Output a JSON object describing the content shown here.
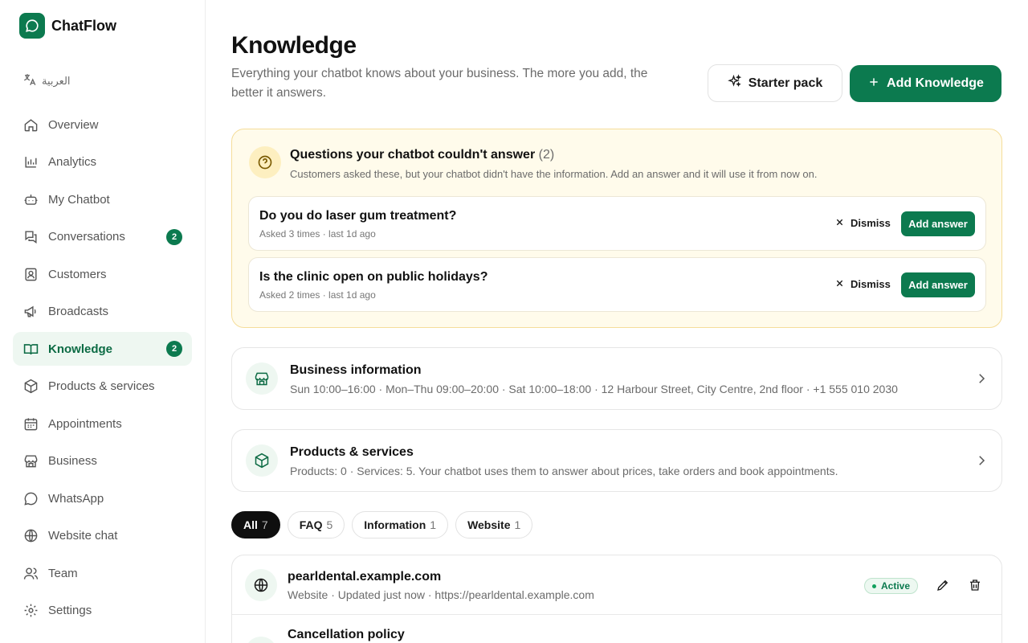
{
  "app": {
    "name": "ChatFlow"
  },
  "sidebar": {
    "language": "العربية",
    "items": [
      {
        "label": "Overview",
        "icon": "home-icon"
      },
      {
        "label": "Analytics",
        "icon": "bar-chart-icon"
      },
      {
        "label": "My Chatbot",
        "icon": "bot-icon"
      },
      {
        "label": "Conversations",
        "icon": "chat-bubbles-icon",
        "badge": "2"
      },
      {
        "label": "Customers",
        "icon": "contact-card-icon"
      },
      {
        "label": "Broadcasts",
        "icon": "megaphone-icon"
      },
      {
        "label": "Knowledge",
        "icon": "book-icon",
        "badge": "2",
        "active": true
      },
      {
        "label": "Products & services",
        "icon": "box-icon"
      },
      {
        "label": "Appointments",
        "icon": "calendar-icon"
      },
      {
        "label": "Business",
        "icon": "store-icon"
      },
      {
        "label": "WhatsApp",
        "icon": "whatsapp-icon"
      },
      {
        "label": "Website chat",
        "icon": "globe-icon"
      },
      {
        "label": "Team",
        "icon": "users-icon"
      },
      {
        "label": "Settings",
        "icon": "gear-icon"
      }
    ]
  },
  "header": {
    "title": "Knowledge",
    "subtitle": "Everything your chatbot knows about your business. The more you add, the better it answers.",
    "starter_label": "Starter pack",
    "add_label": "Add Knowledge"
  },
  "unanswered": {
    "title": "Questions your chatbot couldn't answer",
    "count": "(2)",
    "description": "Customers asked these, but your chatbot didn't have the information. Add an answer and it will use it from now on.",
    "dismiss_label": "Dismiss",
    "add_answer_label": "Add answer",
    "questions": [
      {
        "text": "Do you do laser gum treatment?",
        "meta": "Asked 3 times · last 1d ago"
      },
      {
        "text": "Is the clinic open on public holidays?",
        "meta": "Asked 2 times · last 1d ago"
      }
    ]
  },
  "business_info": {
    "title": "Business information",
    "description": "Sun 10:00–16:00 · Mon–Thu 09:00–20:00 · Sat 10:00–18:00 · 12 Harbour Street, City Centre, 2nd floor · +1 555 010 2030"
  },
  "products": {
    "title": "Products & services",
    "description": "Products: 0 · Services: 5. Your chatbot uses them to answer about prices, take orders and book appointments."
  },
  "filters": [
    {
      "label": "All",
      "count": "7",
      "active": true
    },
    {
      "label": "FAQ",
      "count": "5"
    },
    {
      "label": "Information",
      "count": "1"
    },
    {
      "label": "Website",
      "count": "1"
    }
  ],
  "knowledge_items": [
    {
      "title": "pearldental.example.com",
      "type": "Website",
      "updated": "Updated just now",
      "url": "https://pearldental.example.com",
      "status": "Active"
    },
    {
      "title": "Cancellation policy"
    }
  ],
  "colors": {
    "brand": "#0c7a4f",
    "warning_bg": "#fffbeb",
    "warning_border": "#f5dd9a"
  }
}
